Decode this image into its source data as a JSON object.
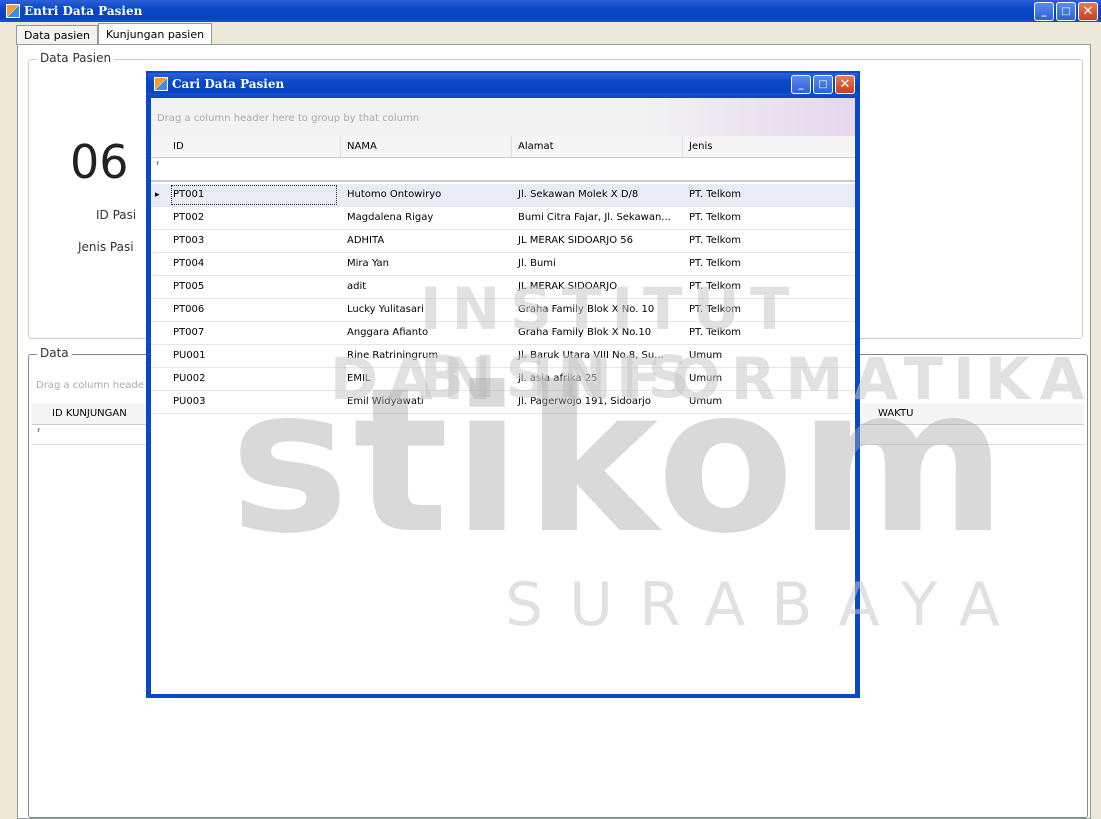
{
  "main_window": {
    "title": "Entri Data Pasien",
    "tabs": [
      "Data pasien",
      "Kunjungan pasien"
    ]
  },
  "data_pasien_group": {
    "label": "Data Pasien",
    "big_number": "06",
    "id_label": "ID Pasi",
    "jenis_label": "Jenis Pasi"
  },
  "data_group": {
    "label": "Data",
    "drag_hint": "Drag a column heade",
    "columns": [
      "ID KUNJUNGAN",
      "WAKTU"
    ],
    "filter_icon": "⸢"
  },
  "dialog": {
    "title": "Cari Data Pasien",
    "drag_hint": "Drag a column header here to group by that column",
    "columns": [
      "ID",
      "NAMA",
      "Alamat",
      "Jenis"
    ],
    "filter_icon": "⸢",
    "row_indicator": "▸",
    "rows": [
      {
        "id": "PT001",
        "nama": "Hutomo Ontowiryo",
        "alamat": "Jl. Sekawan Molek X D/8",
        "jenis": "PT. Telkom"
      },
      {
        "id": "PT002",
        "nama": "Magdalena Rigay",
        "alamat": "Bumi Citra Fajar, Jl. Sekawan...",
        "jenis": "PT. Telkom"
      },
      {
        "id": "PT003",
        "nama": "ADHITA",
        "alamat": "JL MERAK SIDOARJO 56",
        "jenis": "PT. Telkom"
      },
      {
        "id": "PT004",
        "nama": "Mira Yan",
        "alamat": "Jl. Bumi",
        "jenis": "PT. Telkom"
      },
      {
        "id": "PT005",
        "nama": "adit",
        "alamat": "JL MERAK SIDOARJO",
        "jenis": "PT. Telkom"
      },
      {
        "id": "PT006",
        "nama": "Lucky Yulitasari",
        "alamat": "Graha Family Blok X No. 10",
        "jenis": "PT. Telkom"
      },
      {
        "id": "PT007",
        "nama": "Anggara Afianto",
        "alamat": "Graha Family Blok X No.10",
        "jenis": "PT. Telkom"
      },
      {
        "id": "PU001",
        "nama": "Rine Ratriningrum",
        "alamat": "Jl. Baruk Utara VIII No.8, Su...",
        "jenis": "Umum"
      },
      {
        "id": "PU002",
        "nama": "EMIL",
        "alamat": "jl. asia afrika 25",
        "jenis": "Umum"
      },
      {
        "id": "PU003",
        "nama": "Emil Widyawati",
        "alamat": "Jl. Pagerwojo 191, Sidoarjo",
        "jenis": "Umum"
      }
    ]
  },
  "window_buttons": {
    "minimize": "_",
    "maximize": "□",
    "close": "✕"
  },
  "watermark": {
    "line1": "INSTITUT BISNIS",
    "line2": "DAN INFORMATIKA",
    "big": "stikom",
    "city": "SURABAYA"
  }
}
